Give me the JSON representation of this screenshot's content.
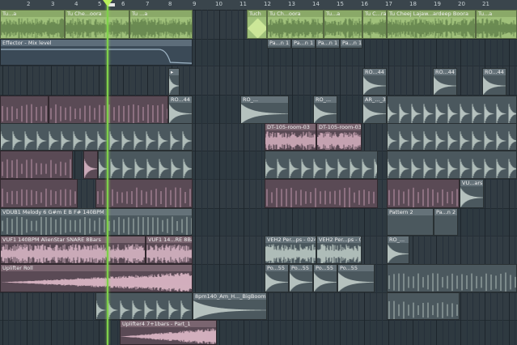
{
  "ruler": {
    "bars": [
      "2",
      "3",
      "4",
      "5",
      "6",
      "7",
      "8",
      "9",
      "10",
      "11",
      "12",
      "13",
      "14",
      "15",
      "16",
      "17",
      "18",
      "19",
      "20",
      "21"
    ]
  },
  "clips": {
    "c1": "Tu...a",
    "c2": "Tu Che...oora",
    "c3": "Tu ...a",
    "c4": "Tuch",
    "c5": "Tu Ch...oora",
    "c6": "Tu...a",
    "c7": "Tu C...ra",
    "c8": "Tu Cheej Lajaw...ardeep Boora",
    "c9": "Tu...a",
    "automation": "Effector - Mix level",
    "pa1": "Pa...n 1",
    "pa2": "Pa...n 1",
    "pa3": "Pa...n 1",
    "pa4": "Pa...n 1",
    "ro1": "RO...44",
    "ro2": "RO...44",
    "ro3": "RO...44",
    "ro4": "RO...44",
    "ro5": "RO_...",
    "ro6": "RO_...",
    "ar": "AR_..._3",
    "dt1": "DT-105-room-03",
    "dt2": "DT-105-room-03",
    "vu": "VU...ars",
    "vdub": "VDUB1 Melody 6 G#m E B  F# 140BPM",
    "pattern2": "Pattern 2",
    "pan2": "Pa...n 2",
    "vuf1": "VUF1 140BPM AlienStar SNARE 8Bars",
    "vuf1b": "VUF1 14...RE 8Bars",
    "veh1": "VEH2 Per...ps - 024",
    "veh2": "VEH2 Per...ps - 024",
    "ro7": "RO_...",
    "uplifter": "Uplifter Roll",
    "po1": "Po...55",
    "po2": "Po...55",
    "po3": "Po...55",
    "po4": "Po...55",
    "bpm": "8pm140_Am_H..._BigBoomFX",
    "uplifter4": "Uplifter4 7+1bars - Part_1"
  }
}
